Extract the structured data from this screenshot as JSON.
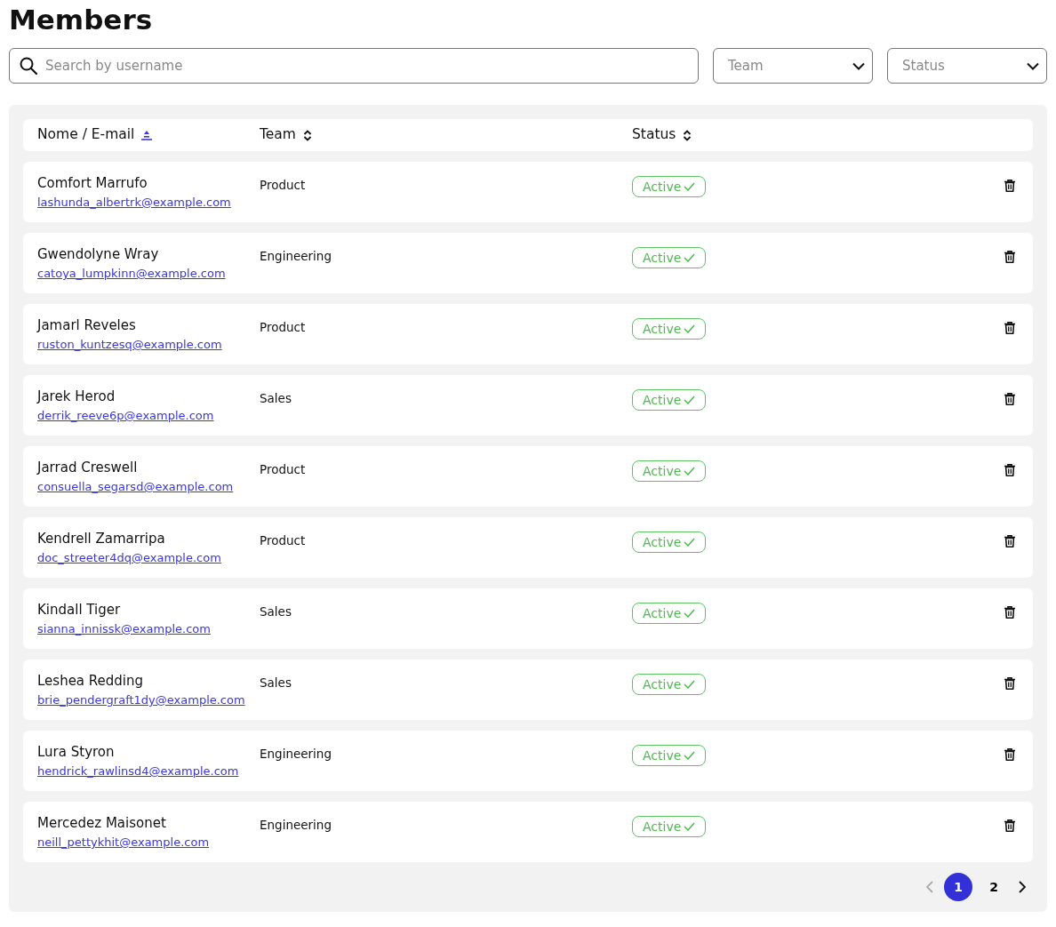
{
  "title": "Members",
  "search": {
    "placeholder": "Search by username"
  },
  "filters": [
    {
      "placeholder": "Team"
    },
    {
      "placeholder": "Status"
    }
  ],
  "columns": [
    {
      "label": "Nome / E-mail",
      "sorted": true
    },
    {
      "label": "Team",
      "sorted": false
    },
    {
      "label": "Status",
      "sorted": false
    }
  ],
  "rows": [
    {
      "name": "Comfort Marrufo",
      "email": "lashunda_albertrk@example.com",
      "team": "Product",
      "status": "Active"
    },
    {
      "name": "Gwendolyne Wray",
      "email": "catoya_lumpkinn@example.com",
      "team": "Engineering",
      "status": "Active"
    },
    {
      "name": "Jamarl Reveles",
      "email": "ruston_kuntzesq@example.com",
      "team": "Product",
      "status": "Active"
    },
    {
      "name": "Jarek Herod",
      "email": "derrik_reeve6p@example.com",
      "team": "Sales",
      "status": "Active"
    },
    {
      "name": "Jarrad Creswell",
      "email": "consuella_segarsd@example.com",
      "team": "Product",
      "status": "Active"
    },
    {
      "name": "Kendrell Zamarripa",
      "email": "doc_streeter4dq@example.com",
      "team": "Product",
      "status": "Active"
    },
    {
      "name": "Kindall Tiger",
      "email": "sianna_innissk@example.com",
      "team": "Sales",
      "status": "Active"
    },
    {
      "name": "Leshea Redding",
      "email": "brie_pendergraft1dy@example.com",
      "team": "Sales",
      "status": "Active"
    },
    {
      "name": "Lura Styron",
      "email": "hendrick_rawlinsd4@example.com",
      "team": "Engineering",
      "status": "Active"
    },
    {
      "name": "Mercedez Maisonet",
      "email": "neill_pettykhit@example.com",
      "team": "Engineering",
      "status": "Active"
    }
  ],
  "pagination": {
    "prev_disabled": true,
    "next_disabled": false,
    "pages": [
      {
        "label": "1",
        "selected": true
      },
      {
        "label": "2",
        "selected": false
      }
    ]
  }
}
